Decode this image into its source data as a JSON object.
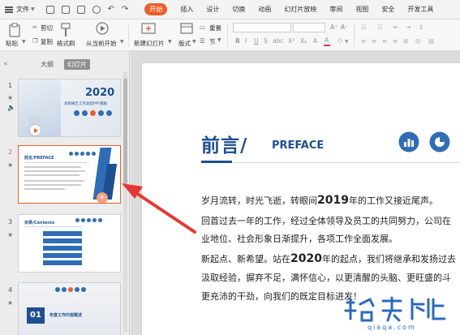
{
  "menubar": {
    "file_label": "文件",
    "tabs": [
      "开始",
      "插入",
      "设计",
      "切换",
      "动画",
      "幻灯片放映",
      "审阅",
      "视图",
      "安全",
      "开发工具"
    ]
  },
  "ribbon": {
    "paste": "粘贴",
    "cut": "剪切",
    "copy": "复制",
    "format_painter": "格式刷",
    "from_current": "从当前开始",
    "new_slide": "新建幻灯片",
    "layout": "版式",
    "section": "节",
    "reset": "重置"
  },
  "left_panel": {
    "tab_outline": "大纲",
    "tab_slides": "幻灯片",
    "slides": [
      {
        "num": "1",
        "year": "2020",
        "subtitle": "述职报告工作总结PPT模板"
      },
      {
        "num": "2",
        "title": "前言/PREFACE"
      },
      {
        "num": "3",
        "title": "目录/Contents"
      },
      {
        "num": "4",
        "section_num": "01",
        "section_title": "年度工作内容概述"
      }
    ]
  },
  "slide": {
    "title_cn": "前言/",
    "title_en": "PREFACE",
    "lines": [
      {
        "pre": "岁月流转，时光飞逝，转眼间",
        "bold": "2019",
        "post": "年的工作又接近尾声。"
      },
      {
        "pre": "回首过去一年的工作，经过全体领导及员工的共同努力，公司在",
        "bold": "",
        "post": ""
      },
      {
        "pre": "业地位、社会形象日渐提升，各项工作全面发展。",
        "bold": "",
        "post": ""
      },
      {
        "pre": "新起点、新希望。站在",
        "bold": "2020",
        "post": "年的起点，我们将继承和发扬过去"
      },
      {
        "pre": "汲取经验，摒弃不足，满怀信心，以更清醒的头脑、更旺盛的斗",
        "bold": "",
        "post": ""
      },
      {
        "pre": "更充沛的干劲，向我们的既定目标进发！",
        "bold": "",
        "post": ""
      }
    ]
  },
  "watermark": {
    "text": "哈卡迪",
    "url": "qiaqa.com"
  },
  "colors": {
    "accent": "#e8602c",
    "title_blue": "#1e4f8f",
    "icon_blue": "#2f6db5"
  }
}
